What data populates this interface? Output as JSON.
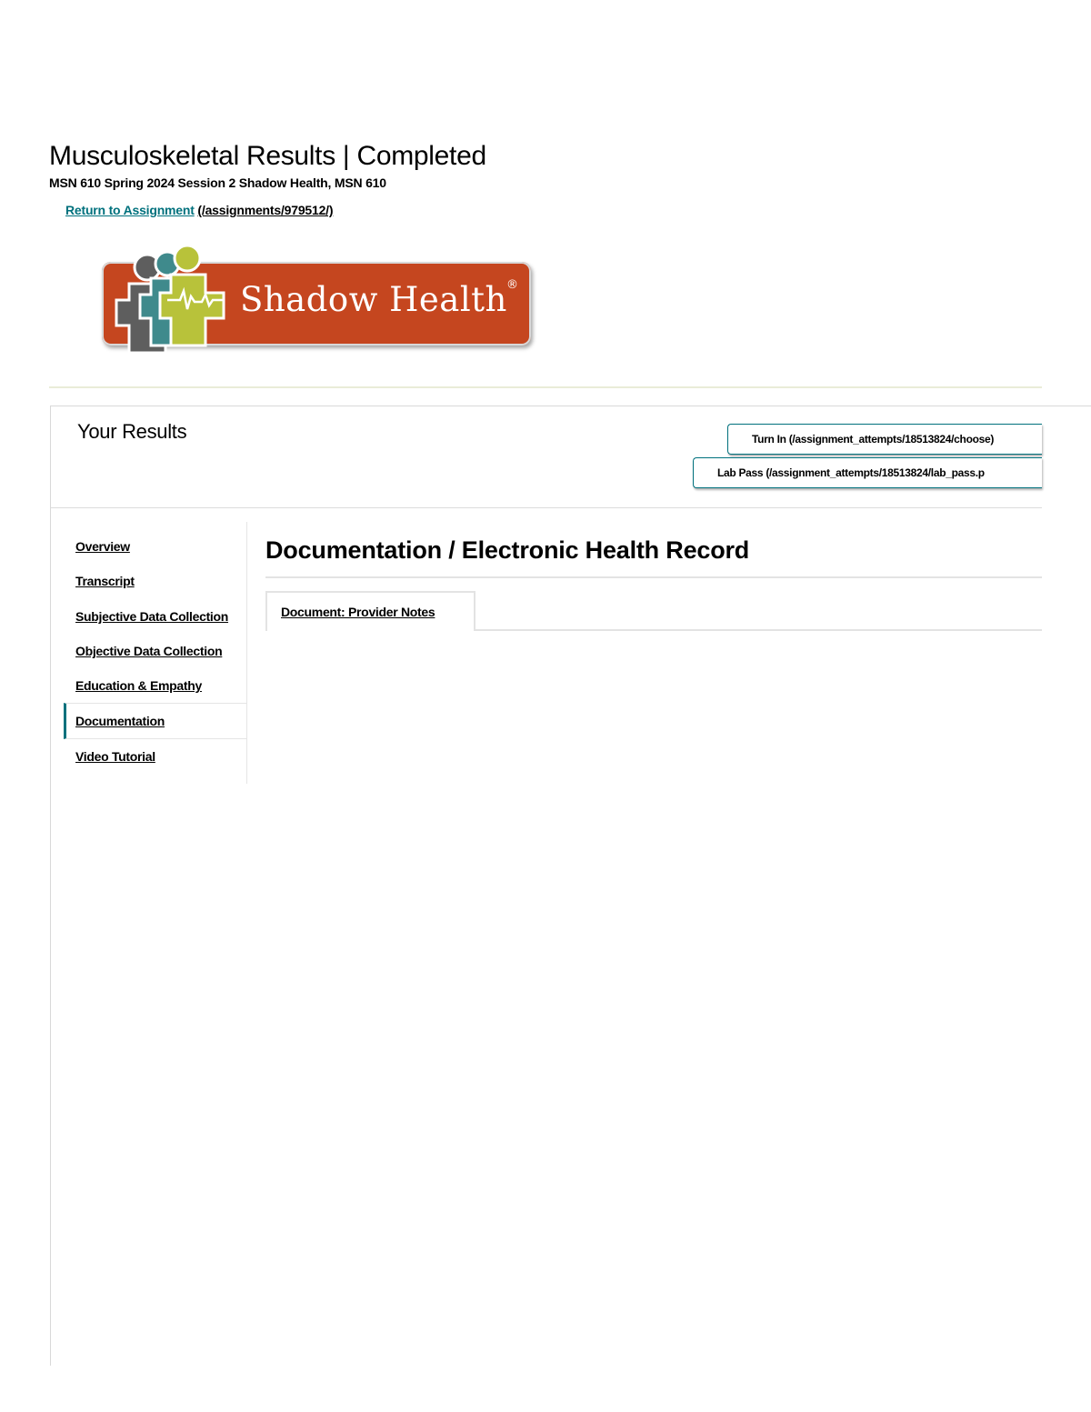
{
  "header": {
    "title": "Musculoskeletal Results | Completed",
    "subtitle": "MSN 610 Spring 2024 Session 2 Shadow Health, MSN 610",
    "return_link": {
      "label": "Return to Assignment",
      "path": "(/assignments/979512/)"
    }
  },
  "logo": {
    "text": "Shadow Health",
    "registered_mark": "®",
    "icon": "shadow-health-figure-logo",
    "banner_color": "#c5461f"
  },
  "results": {
    "title": "Your Results",
    "buttons": {
      "turn_in": "Turn In (/assignment_attempts/18513824/choose)",
      "lab_pass": "Lab Pass (/assignment_attempts/18513824/lab_pass.p"
    }
  },
  "sidebar": {
    "items": [
      {
        "label": "Overview",
        "active": false
      },
      {
        "label": "Transcript",
        "active": false
      },
      {
        "label": "Subjective Data Collection",
        "active": false
      },
      {
        "label": "Objective Data Collection",
        "active": false
      },
      {
        "label": "Education & Empathy",
        "active": false
      },
      {
        "label": "Documentation",
        "active": true
      },
      {
        "label": "Video Tutorial",
        "active": false
      }
    ]
  },
  "content": {
    "title": "Documentation / Electronic Health Record",
    "tabs": [
      {
        "label": "Document: Provider Notes"
      }
    ]
  },
  "colors": {
    "accent": "#00717d"
  }
}
